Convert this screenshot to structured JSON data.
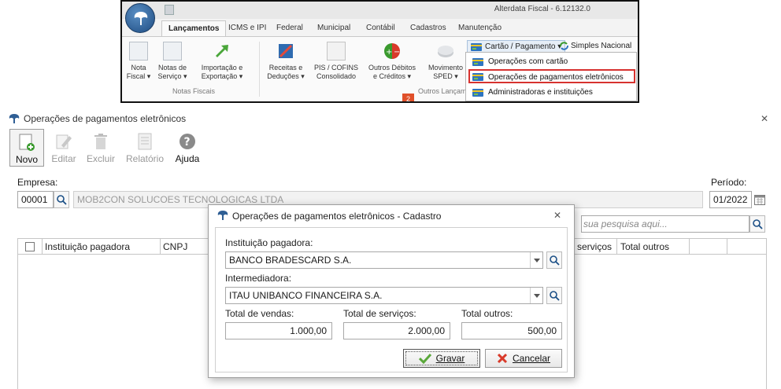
{
  "ribbon": {
    "app_title": "Alterdata Fiscal - 6.12132.0",
    "tabs": [
      "Lançamentos",
      "ICMS e IPI",
      "Federal",
      "Municipal",
      "Contábil",
      "Cadastros",
      "Manutenção"
    ],
    "buttons": [
      {
        "label1": "Nota",
        "label2": "Fiscal ▾"
      },
      {
        "label1": "Notas de",
        "label2": "Serviço ▾"
      },
      {
        "label1": "Importação e",
        "label2": "Exportação ▾"
      },
      {
        "label1": "Receitas e",
        "label2": "Deduções ▾"
      },
      {
        "label1": "PIS / COFINS",
        "label2": "Consolidado"
      },
      {
        "label1": "Outros Débitos",
        "label2": "e Créditos ▾"
      },
      {
        "label1": "Movimento",
        "label2": "SPED ▾"
      }
    ],
    "group_labels": [
      "Notas Fiscais",
      "Outros Lançam"
    ],
    "badge": "2",
    "cartao_label": "Cartão / Pagamento ▾",
    "simples_label": "Simples Nacional ▾",
    "dropdown_items": [
      "Operações com cartão",
      "Operações de pagamentos eletrônicos",
      "Administradoras e instituições"
    ]
  },
  "window": {
    "title": "Operações de pagamentos eletrônicos",
    "toolbar": [
      "Novo",
      "Editar",
      "Excluir",
      "Relatório",
      "Ajuda"
    ],
    "empresa_label": "Empresa:",
    "empresa_code": "00001",
    "empresa_name": "MOB2CON SOLUCOES TECNOLOGICAS LTDA",
    "periodo_label": "Período:",
    "periodo_value": "01/2022",
    "search_placeholder": "sua pesquisa aqui...",
    "columns": [
      "Instituição pagadora",
      "CNPJ",
      "serviços",
      "Total outros"
    ]
  },
  "modal": {
    "title": "Operações de pagamentos eletrônicos - Cadastro",
    "instituicao_label": "Instituição pagadora:",
    "instituicao_value": "BANCO BRADESCARD S.A.",
    "intermediadora_label": "Intermediadora:",
    "intermediadora_value": "ITAU UNIBANCO FINANCEIRA S.A.",
    "vendas_label": "Total de vendas:",
    "vendas_value": "1.000,00",
    "servicos_label": "Total de serviços:",
    "servicos_value": "2.000,00",
    "outros_label": "Total outros:",
    "outros_value": "500,00",
    "gravar_label": "Gravar",
    "cancelar_label": "Cancelar"
  },
  "colors": {
    "highlight": "#d7322f",
    "accent_green": "#3a9a2e",
    "accent_red": "#d93a2a"
  }
}
